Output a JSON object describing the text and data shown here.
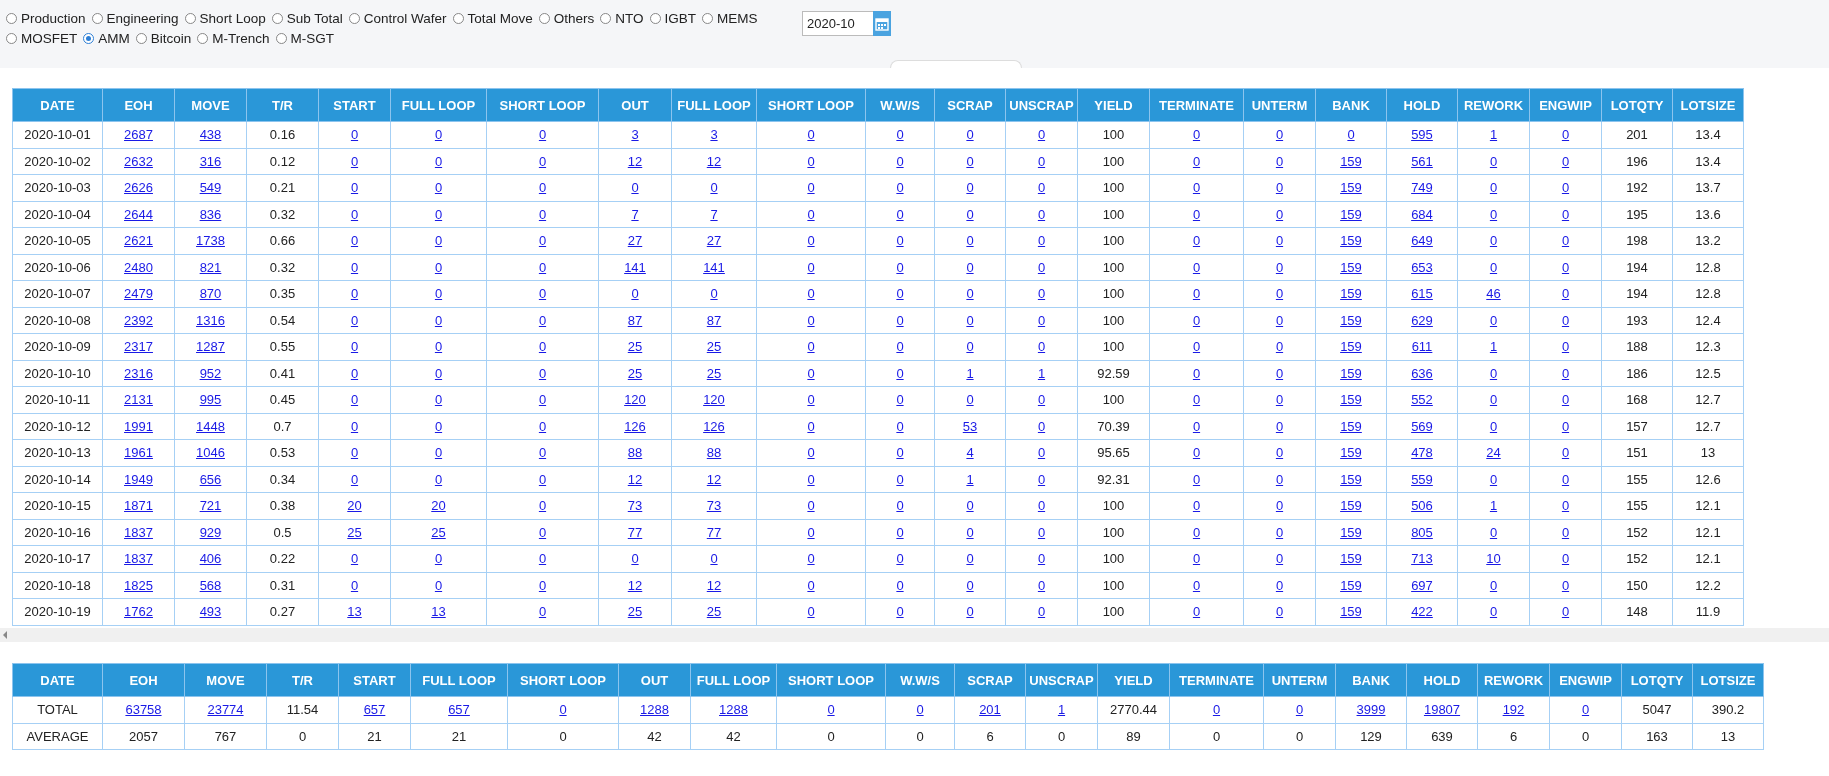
{
  "filters": [
    {
      "label": "Production",
      "selected": false
    },
    {
      "label": "Engineering",
      "selected": false
    },
    {
      "label": "Short Loop",
      "selected": false
    },
    {
      "label": "Sub Total",
      "selected": false
    },
    {
      "label": "Control Wafer",
      "selected": false
    },
    {
      "label": "Total Move",
      "selected": false
    },
    {
      "label": "Others",
      "selected": false
    },
    {
      "label": "NTO",
      "selected": false
    },
    {
      "label": "IGBT",
      "selected": false
    },
    {
      "label": "MEMS",
      "selected": false
    },
    {
      "label": "MOSFET",
      "selected": false
    },
    {
      "label": "AMM",
      "selected": true
    },
    {
      "label": "Bitcoin",
      "selected": false
    },
    {
      "label": "M-Trench",
      "selected": false
    },
    {
      "label": "M-SGT",
      "selected": false
    }
  ],
  "month_field": {
    "value": "2020-10"
  },
  "daily_table": {
    "columns": [
      {
        "label": "DATE",
        "kind": "text"
      },
      {
        "label": "EOH",
        "kind": "link"
      },
      {
        "label": "MOVE",
        "kind": "link"
      },
      {
        "label": "T/R",
        "kind": "text"
      },
      {
        "label": "START",
        "kind": "link"
      },
      {
        "label": "FULL LOOP",
        "kind": "link"
      },
      {
        "label": "SHORT LOOP",
        "kind": "link"
      },
      {
        "label": "OUT",
        "kind": "link"
      },
      {
        "label": "FULL LOOP",
        "kind": "link"
      },
      {
        "label": "SHORT LOOP",
        "kind": "link"
      },
      {
        "label": "W.W/S",
        "kind": "link"
      },
      {
        "label": "SCRAP",
        "kind": "link"
      },
      {
        "label": "UNSCRAP",
        "kind": "link"
      },
      {
        "label": "YIELD",
        "kind": "text"
      },
      {
        "label": "TERMINATE",
        "kind": "link"
      },
      {
        "label": "UNTERM",
        "kind": "link"
      },
      {
        "label": "BANK",
        "kind": "link"
      },
      {
        "label": "HOLD",
        "kind": "link"
      },
      {
        "label": "REWORK",
        "kind": "link"
      },
      {
        "label": "ENGWIP",
        "kind": "link"
      },
      {
        "label": "LOTQTY",
        "kind": "text"
      },
      {
        "label": "LOTSIZE",
        "kind": "text"
      }
    ],
    "rows": [
      [
        "2020-10-01",
        "2687",
        "438",
        "0.16",
        "0",
        "0",
        "0",
        "3",
        "3",
        "0",
        "0",
        "0",
        "0",
        "100",
        "0",
        "0",
        "0",
        "595",
        "1",
        "0",
        "201",
        "13.4"
      ],
      [
        "2020-10-02",
        "2632",
        "316",
        "0.12",
        "0",
        "0",
        "0",
        "12",
        "12",
        "0",
        "0",
        "0",
        "0",
        "100",
        "0",
        "0",
        "159",
        "561",
        "0",
        "0",
        "196",
        "13.4"
      ],
      [
        "2020-10-03",
        "2626",
        "549",
        "0.21",
        "0",
        "0",
        "0",
        "0",
        "0",
        "0",
        "0",
        "0",
        "0",
        "100",
        "0",
        "0",
        "159",
        "749",
        "0",
        "0",
        "192",
        "13.7"
      ],
      [
        "2020-10-04",
        "2644",
        "836",
        "0.32",
        "0",
        "0",
        "0",
        "7",
        "7",
        "0",
        "0",
        "0",
        "0",
        "100",
        "0",
        "0",
        "159",
        "684",
        "0",
        "0",
        "195",
        "13.6"
      ],
      [
        "2020-10-05",
        "2621",
        "1738",
        "0.66",
        "0",
        "0",
        "0",
        "27",
        "27",
        "0",
        "0",
        "0",
        "0",
        "100",
        "0",
        "0",
        "159",
        "649",
        "0",
        "0",
        "198",
        "13.2"
      ],
      [
        "2020-10-06",
        "2480",
        "821",
        "0.32",
        "0",
        "0",
        "0",
        "141",
        "141",
        "0",
        "0",
        "0",
        "0",
        "100",
        "0",
        "0",
        "159",
        "653",
        "0",
        "0",
        "194",
        "12.8"
      ],
      [
        "2020-10-07",
        "2479",
        "870",
        "0.35",
        "0",
        "0",
        "0",
        "0",
        "0",
        "0",
        "0",
        "0",
        "0",
        "100",
        "0",
        "0",
        "159",
        "615",
        "46",
        "0",
        "194",
        "12.8"
      ],
      [
        "2020-10-08",
        "2392",
        "1316",
        "0.54",
        "0",
        "0",
        "0",
        "87",
        "87",
        "0",
        "0",
        "0",
        "0",
        "100",
        "0",
        "0",
        "159",
        "629",
        "0",
        "0",
        "193",
        "12.4"
      ],
      [
        "2020-10-09",
        "2317",
        "1287",
        "0.55",
        "0",
        "0",
        "0",
        "25",
        "25",
        "0",
        "0",
        "0",
        "0",
        "100",
        "0",
        "0",
        "159",
        "611",
        "1",
        "0",
        "188",
        "12.3"
      ],
      [
        "2020-10-10",
        "2316",
        "952",
        "0.41",
        "0",
        "0",
        "0",
        "25",
        "25",
        "0",
        "0",
        "1",
        "1",
        "92.59",
        "0",
        "0",
        "159",
        "636",
        "0",
        "0",
        "186",
        "12.5"
      ],
      [
        "2020-10-11",
        "2131",
        "995",
        "0.45",
        "0",
        "0",
        "0",
        "120",
        "120",
        "0",
        "0",
        "0",
        "0",
        "100",
        "0",
        "0",
        "159",
        "552",
        "0",
        "0",
        "168",
        "12.7"
      ],
      [
        "2020-10-12",
        "1991",
        "1448",
        "0.7",
        "0",
        "0",
        "0",
        "126",
        "126",
        "0",
        "0",
        "53",
        "0",
        "70.39",
        "0",
        "0",
        "159",
        "569",
        "0",
        "0",
        "157",
        "12.7"
      ],
      [
        "2020-10-13",
        "1961",
        "1046",
        "0.53",
        "0",
        "0",
        "0",
        "88",
        "88",
        "0",
        "0",
        "4",
        "0",
        "95.65",
        "0",
        "0",
        "159",
        "478",
        "24",
        "0",
        "151",
        "13"
      ],
      [
        "2020-10-14",
        "1949",
        "656",
        "0.34",
        "0",
        "0",
        "0",
        "12",
        "12",
        "0",
        "0",
        "1",
        "0",
        "92.31",
        "0",
        "0",
        "159",
        "559",
        "0",
        "0",
        "155",
        "12.6"
      ],
      [
        "2020-10-15",
        "1871",
        "721",
        "0.38",
        "20",
        "20",
        "0",
        "73",
        "73",
        "0",
        "0",
        "0",
        "0",
        "100",
        "0",
        "0",
        "159",
        "506",
        "1",
        "0",
        "155",
        "12.1"
      ],
      [
        "2020-10-16",
        "1837",
        "929",
        "0.5",
        "25",
        "25",
        "0",
        "77",
        "77",
        "0",
        "0",
        "0",
        "0",
        "100",
        "0",
        "0",
        "159",
        "805",
        "0",
        "0",
        "152",
        "12.1"
      ],
      [
        "2020-10-17",
        "1837",
        "406",
        "0.22",
        "0",
        "0",
        "0",
        "0",
        "0",
        "0",
        "0",
        "0",
        "0",
        "100",
        "0",
        "0",
        "159",
        "713",
        "10",
        "0",
        "152",
        "12.1"
      ],
      [
        "2020-10-18",
        "1825",
        "568",
        "0.31",
        "0",
        "0",
        "0",
        "12",
        "12",
        "0",
        "0",
        "0",
        "0",
        "100",
        "0",
        "0",
        "159",
        "697",
        "0",
        "0",
        "150",
        "12.2"
      ],
      [
        "2020-10-19",
        "1762",
        "493",
        "0.27",
        "13",
        "13",
        "0",
        "25",
        "25",
        "0",
        "0",
        "0",
        "0",
        "100",
        "0",
        "0",
        "159",
        "422",
        "0",
        "0",
        "148",
        "11.9"
      ]
    ]
  },
  "summary_table": {
    "columns": [
      {
        "label": "DATE",
        "kind": "text"
      },
      {
        "label": "EOH",
        "kind": "link"
      },
      {
        "label": "MOVE",
        "kind": "link"
      },
      {
        "label": "T/R",
        "kind": "text"
      },
      {
        "label": "START",
        "kind": "link"
      },
      {
        "label": "FULL LOOP",
        "kind": "link"
      },
      {
        "label": "SHORT LOOP",
        "kind": "link"
      },
      {
        "label": "OUT",
        "kind": "link"
      },
      {
        "label": "FULL LOOP",
        "kind": "link"
      },
      {
        "label": "SHORT LOOP",
        "kind": "link"
      },
      {
        "label": "W.W/S",
        "kind": "link"
      },
      {
        "label": "SCRAP",
        "kind": "link"
      },
      {
        "label": "UNSCRAP",
        "kind": "link"
      },
      {
        "label": "YIELD",
        "kind": "text"
      },
      {
        "label": "TERMINATE",
        "kind": "link"
      },
      {
        "label": "UNTERM",
        "kind": "link"
      },
      {
        "label": "BANK",
        "kind": "link"
      },
      {
        "label": "HOLD",
        "kind": "link"
      },
      {
        "label": "REWORK",
        "kind": "link"
      },
      {
        "label": "ENGWIP",
        "kind": "link"
      },
      {
        "label": "LOTQTY",
        "kind": "text"
      },
      {
        "label": "LOTSIZE",
        "kind": "text"
      }
    ],
    "rows": [
      {
        "linked": true,
        "cells": [
          "TOTAL",
          "63758",
          "23774",
          "11.54",
          "657",
          "657",
          "0",
          "1288",
          "1288",
          "0",
          "0",
          "201",
          "1",
          "2770.44",
          "0",
          "0",
          "3999",
          "19807",
          "192",
          "0",
          "5047",
          "390.2"
        ]
      },
      {
        "linked": false,
        "cells": [
          "AVERAGE",
          "2057",
          "767",
          "0",
          "21",
          "21",
          "0",
          "42",
          "42",
          "0",
          "0",
          "6",
          "0",
          "89",
          "0",
          "0",
          "129",
          "639",
          "6",
          "0",
          "163",
          "13"
        ]
      }
    ]
  }
}
